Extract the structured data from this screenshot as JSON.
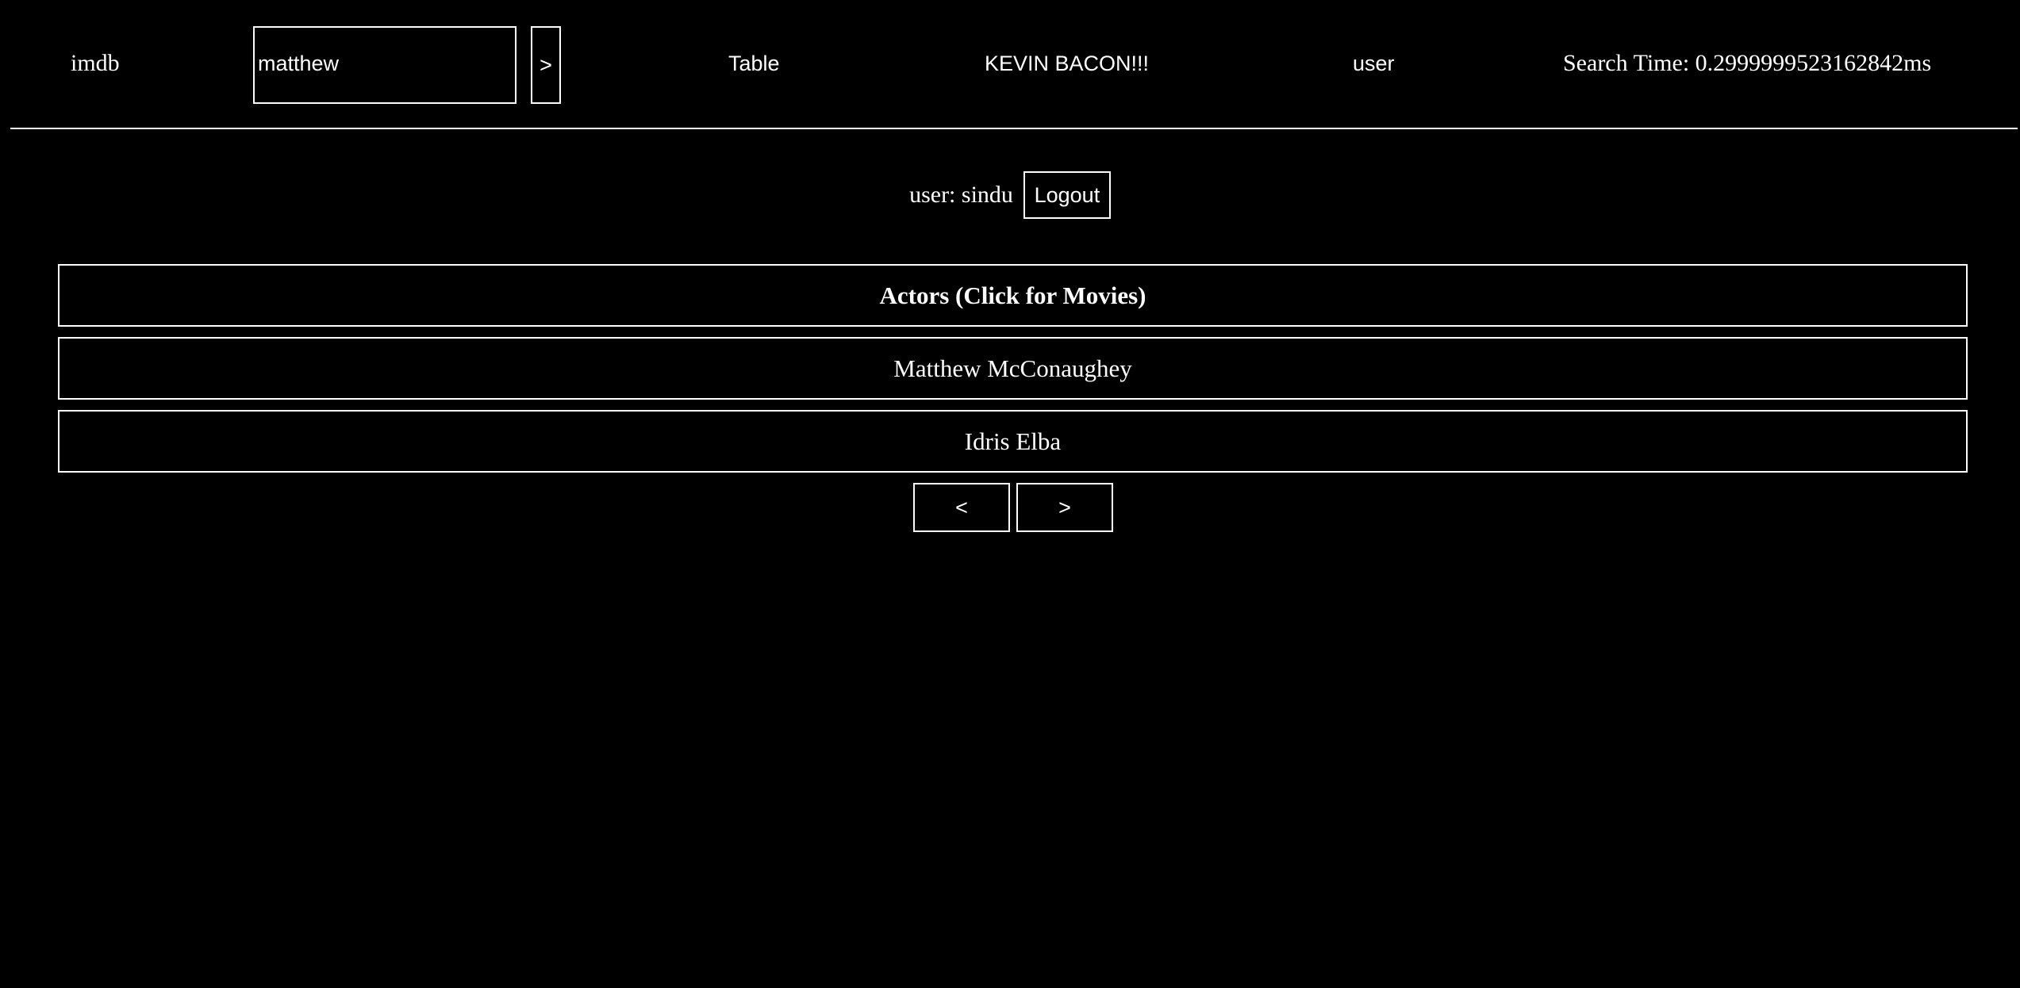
{
  "header": {
    "brand": "imdb",
    "search": {
      "value": "matthew",
      "placeholder": ""
    },
    "go_label": ">",
    "nav": {
      "table": "Table",
      "kevin_bacon": "KEVIN BACON!!!",
      "user": "user"
    },
    "search_time": "Search Time: 0.2999999523162842ms"
  },
  "session": {
    "user_label": "user: sindu",
    "logout_label": "Logout"
  },
  "results": {
    "header": "Actors (Click for Movies)",
    "rows": [
      "Matthew McConaughey",
      "Idris Elba"
    ]
  },
  "pager": {
    "prev_label": "<",
    "next_label": ">"
  },
  "colors": {
    "background": "#000000",
    "foreground": "#ffffff"
  }
}
